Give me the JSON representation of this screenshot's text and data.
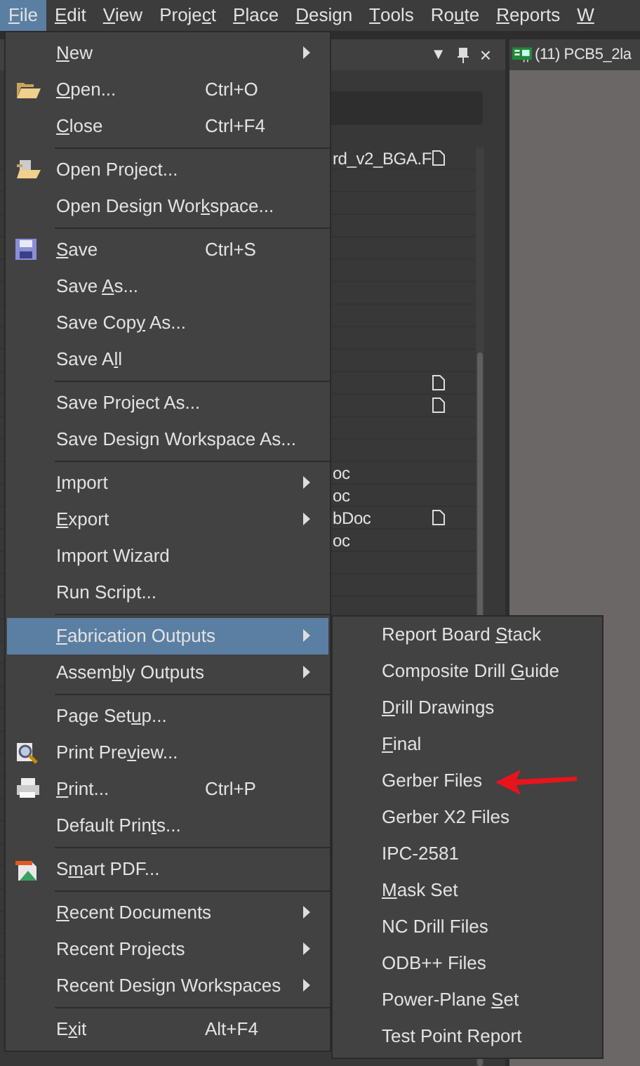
{
  "menu_bar": [
    {
      "label": {
        "key": "F",
        "post": "ile"
      },
      "selected": true
    },
    {
      "label": {
        "key": "E",
        "post": "dit"
      },
      "selected": false
    },
    {
      "label": {
        "key": "V",
        "post": "iew"
      },
      "selected": false
    },
    {
      "label": {
        "pre": "Proje",
        "key": "c",
        "post": "t"
      },
      "selected": false
    },
    {
      "label": {
        "key": "P",
        "post": "lace"
      },
      "selected": false
    },
    {
      "label": {
        "key": "D",
        "post": "esign"
      },
      "selected": false
    },
    {
      "label": {
        "key": "T",
        "post": "ools"
      },
      "selected": false
    },
    {
      "label": {
        "pre": "Ro",
        "key": "u",
        "post": "te"
      },
      "selected": false
    },
    {
      "label": {
        "key": "R",
        "post": "eports"
      },
      "selected": false
    },
    {
      "label": {
        "key": "W"
      },
      "selected": false
    }
  ],
  "panel": {
    "controls": [
      "▼",
      "×"
    ],
    "rows": [
      {
        "text": "rd_v2_BGA.F",
        "doc": true
      },
      {},
      {},
      {},
      {},
      {},
      {},
      {},
      {},
      {},
      {
        "doc": true
      },
      {
        "doc": true
      },
      {},
      {},
      {
        "text": "oc"
      },
      {
        "text": "oc"
      },
      {
        "text": "bDoc",
        "doc": true
      },
      {
        "text": "oc"
      },
      {},
      {},
      {},
      {},
      {},
      {},
      {},
      {},
      {},
      {},
      {},
      {},
      {},
      {},
      {},
      {},
      {},
      {},
      {}
    ]
  },
  "document_tab": {
    "title": "(11) PCB5_2la"
  },
  "file_menu": {
    "items": [
      {
        "kind": "item",
        "label": {
          "key": "N",
          "post": "ew"
        },
        "submenu": true,
        "selected": false
      },
      {
        "kind": "item",
        "label": {
          "key": "O",
          "post": "pen..."
        },
        "shortcut": "Ctrl+O",
        "selected": false
      },
      {
        "kind": "item",
        "label": {
          "key": "C",
          "post": "lose"
        },
        "shortcut": "Ctrl+F4",
        "selected": false
      },
      {
        "kind": "separator"
      },
      {
        "kind": "item",
        "label": {
          "pre": "Open Project..."
        },
        "selected": false
      },
      {
        "kind": "item",
        "label": {
          "pre": "Open Design Wor",
          "key": "k",
          "post": "space..."
        },
        "selected": false
      },
      {
        "kind": "separator"
      },
      {
        "kind": "item",
        "label": {
          "key": "S",
          "post": "ave"
        },
        "shortcut": "Ctrl+S",
        "selected": false
      },
      {
        "kind": "item",
        "label": {
          "pre": "Save ",
          "key": "A",
          "post": "s..."
        },
        "selected": false
      },
      {
        "kind": "item",
        "label": {
          "pre": "Save Cop",
          "key": "y",
          "post": " As..."
        },
        "selected": false
      },
      {
        "kind": "item",
        "label": {
          "pre": "Save A",
          "key": "l",
          "post": "l"
        },
        "selected": false
      },
      {
        "kind": "separator"
      },
      {
        "kind": "item",
        "label": {
          "pre": "Save Project As..."
        },
        "selected": false
      },
      {
        "kind": "item",
        "label": {
          "pre": "Save Design Workspace As..."
        },
        "selected": false
      },
      {
        "kind": "separator"
      },
      {
        "kind": "item",
        "label": {
          "key": "I",
          "post": "mport"
        },
        "submenu": true,
        "selected": false
      },
      {
        "kind": "item",
        "label": {
          "key": "E",
          "post": "xport"
        },
        "submenu": true,
        "selected": false
      },
      {
        "kind": "item",
        "label": {
          "pre": "Import Wizard"
        },
        "selected": false
      },
      {
        "kind": "item",
        "label": {
          "pre": "Run Script..."
        },
        "selected": false
      },
      {
        "kind": "separator"
      },
      {
        "kind": "item",
        "label": {
          "key": "F",
          "post": "abrication Outputs"
        },
        "submenu": true,
        "selected": true
      },
      {
        "kind": "item",
        "label": {
          "pre": "Assem",
          "key": "b",
          "post": "ly Outputs"
        },
        "submenu": true,
        "selected": false
      },
      {
        "kind": "separator"
      },
      {
        "kind": "item",
        "label": {
          "pre": "Page Set",
          "key": "u",
          "post": "p..."
        },
        "selected": false
      },
      {
        "kind": "item",
        "label": {
          "pre": "Print Pre",
          "key": "v",
          "post": "iew..."
        },
        "selected": false
      },
      {
        "kind": "item",
        "label": {
          "key": "P",
          "post": "rint..."
        },
        "shortcut": "Ctrl+P",
        "selected": false
      },
      {
        "kind": "item",
        "label": {
          "pre": "Default Prin",
          "key": "t",
          "post": "s..."
        },
        "selected": false
      },
      {
        "kind": "separator"
      },
      {
        "kind": "item",
        "label": {
          "pre": "S",
          "key": "m",
          "post": "art PDF..."
        },
        "selected": false
      },
      {
        "kind": "separator"
      },
      {
        "kind": "item",
        "label": {
          "key": "R",
          "post": "ecent Documents"
        },
        "submenu": true,
        "selected": false
      },
      {
        "kind": "item",
        "label": {
          "pre": "Recent Projects"
        },
        "submenu": true,
        "selected": false
      },
      {
        "kind": "item",
        "label": {
          "pre": "Recent Design Workspaces"
        },
        "submenu": true,
        "selected": false
      },
      {
        "kind": "separator"
      },
      {
        "kind": "item",
        "label": {
          "pre": "E",
          "key": "x",
          "post": "it"
        },
        "shortcut": "Alt+F4",
        "selected": false
      }
    ]
  },
  "fabrication_submenu": {
    "items": [
      {
        "label": {
          "pre": "Report Board ",
          "key": "S",
          "post": "tack"
        },
        "annotated": false
      },
      {
        "label": {
          "pre": "Composite Drill ",
          "key": "G",
          "post": "uide"
        },
        "annotated": false
      },
      {
        "label": {
          "key": "D",
          "post": "rill Drawings"
        },
        "annotated": false
      },
      {
        "label": {
          "key": "F",
          "post": "inal"
        },
        "annotated": false
      },
      {
        "label": {
          "pre": "Gerber Files"
        },
        "annotated": true
      },
      {
        "label": {
          "pre": "Gerber X2 Files"
        },
        "annotated": false
      },
      {
        "label": {
          "pre": "IPC-2581"
        },
        "annotated": false
      },
      {
        "label": {
          "key": "M",
          "post": "ask Set"
        },
        "annotated": false
      },
      {
        "label": {
          "pre": "NC Drill Files"
        },
        "annotated": false
      },
      {
        "label": {
          "pre": "ODB++ Files"
        },
        "annotated": false
      },
      {
        "label": {
          "pre": "Power-Plane ",
          "key": "S",
          "post": "et"
        },
        "annotated": false
      },
      {
        "label": {
          "pre": "Test Point Report"
        },
        "annotated": false
      }
    ]
  }
}
